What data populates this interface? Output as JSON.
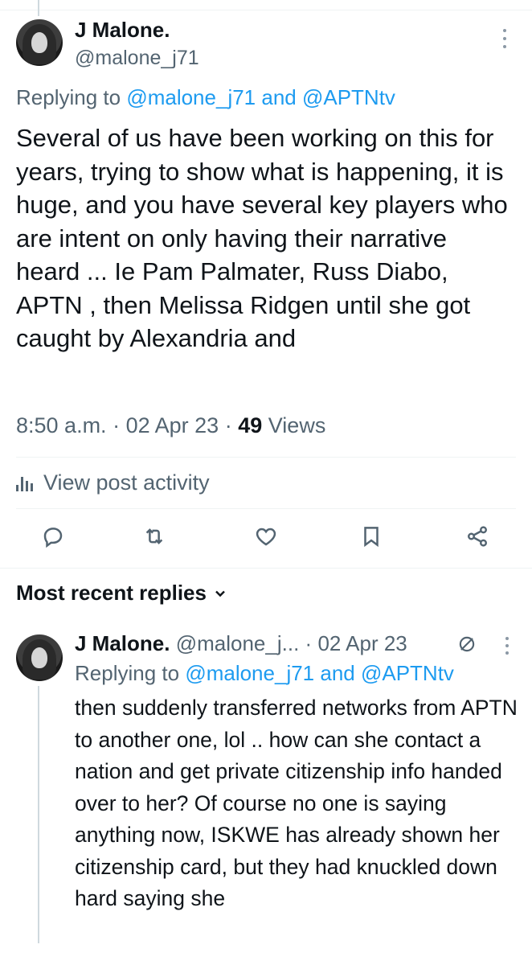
{
  "tweet": {
    "author_name": "J Malone.",
    "author_handle": "@malone_j71",
    "replying_prefix": "Replying to ",
    "replying_to_1": "@malone_j71",
    "replying_conjunction": " and ",
    "replying_to_2": "@APTNtv",
    "text": "Several of us have been working on this for years, trying to show what is happening, it is huge, and you have several key players who are intent on only having their narrative heard ... Ie Pam Palmater, Russ Diabo, APTN , then Melissa Ridgen until she got caught by Alexandria and",
    "time": "8:50 a.m.",
    "date": "02 Apr 23",
    "views_count": "49",
    "views_label": "Views",
    "separator": "·",
    "activity_label": "View post activity"
  },
  "actions": {
    "icons": [
      "reply-icon",
      "repost-icon",
      "like-icon",
      "bookmark-icon",
      "share-icon"
    ]
  },
  "replies_section": {
    "label": "Most recent replies"
  },
  "reply": {
    "author_name": "J Malone.",
    "author_handle": "@malone_j...",
    "separator": "·",
    "date": "02 Apr 23",
    "replying_prefix": "Replying to ",
    "replying_to_1": "@malone_j71",
    "replying_conjunction": " and ",
    "replying_to_2": "@APTNtv",
    "text": "then suddenly transferred networks from APTN to another one, lol .. how can she contact a nation and get private citizenship info handed over to her? Of course no one is saying anything now, ISKWE has already shown her citizenship card, but they had knuckled down hard saying she"
  },
  "colors": {
    "accent": "#1d9bf0",
    "secondary_text": "#536471",
    "primary_text": "#0f1419",
    "divider": "#eff3f4"
  }
}
